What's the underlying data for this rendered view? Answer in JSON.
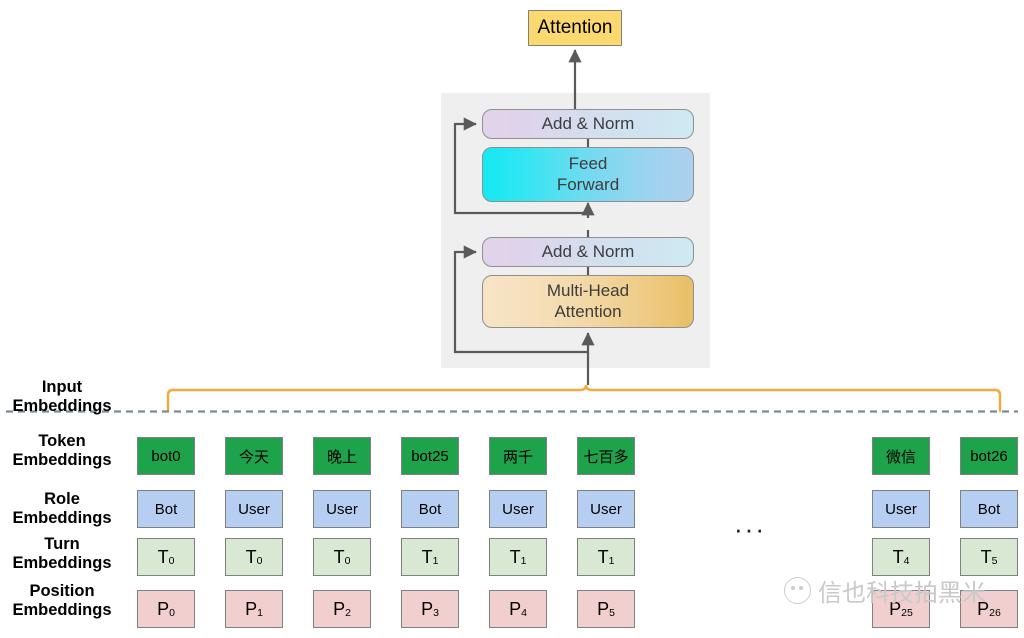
{
  "diagram": {
    "title": "Attention",
    "output_box": {
      "label": "Attention",
      "color": "#fcd96e"
    },
    "transformer_block": {
      "blocks": [
        {
          "name": "add-norm-top",
          "label": "Add & Norm",
          "lines": [
            "Add & Norm"
          ]
        },
        {
          "name": "feed-forward",
          "label": "Feed Forward",
          "lines": [
            "Feed",
            "Forward"
          ]
        },
        {
          "name": "add-norm-bottom",
          "label": "Add & Norm",
          "lines": [
            "Add & Norm"
          ]
        },
        {
          "name": "multi-head-attention",
          "label": "Multi-Head Attention",
          "lines": [
            "Multi-Head",
            "Attention"
          ]
        }
      ]
    },
    "row_labels": [
      {
        "line1": "Input",
        "line2": "Embeddings"
      },
      {
        "line1": "Token",
        "line2": "Embeddings"
      },
      {
        "line1": "Role",
        "line2": "Embeddings"
      },
      {
        "line1": "Turn",
        "line2": "Embeddings"
      },
      {
        "line1": "Position",
        "line2": "Embeddings"
      }
    ],
    "ellipsis": "···",
    "columns_left": [
      {
        "token": "bot0",
        "role": "Bot",
        "turn_base": "T",
        "turn_sub": "0",
        "pos_base": "P",
        "pos_sub": "0"
      },
      {
        "token": "今天",
        "role": "User",
        "turn_base": "T",
        "turn_sub": "0",
        "pos_base": "P",
        "pos_sub": "1"
      },
      {
        "token": "晚上",
        "role": "User",
        "turn_base": "T",
        "turn_sub": "0",
        "pos_base": "P",
        "pos_sub": "2"
      },
      {
        "token": "bot25",
        "role": "Bot",
        "turn_base": "T",
        "turn_sub": "1",
        "pos_base": "P",
        "pos_sub": "3"
      },
      {
        "token": "两千",
        "role": "User",
        "turn_base": "T",
        "turn_sub": "1",
        "pos_base": "P",
        "pos_sub": "4"
      },
      {
        "token": "七百多",
        "role": "User",
        "turn_base": "T",
        "turn_sub": "1",
        "pos_base": "P",
        "pos_sub": "5"
      }
    ],
    "columns_right": [
      {
        "token": "微信",
        "role": "User",
        "turn_base": "T",
        "turn_sub": "4",
        "pos_base": "P",
        "pos_sub": "25"
      },
      {
        "token": "bot26",
        "role": "Bot",
        "turn_base": "T",
        "turn_sub": "5",
        "pos_base": "P",
        "pos_sub": "26"
      }
    ],
    "colors": {
      "token_fill": "#1fa24c",
      "role_fill": "#b5cef2",
      "turn_fill": "#d9e8d2",
      "position_fill": "#f2cfcf",
      "bracket": "#f5a93c",
      "dashed_line": "#7b8a99",
      "block_bg": "#efefef",
      "attention_fill": "#fcd96e"
    }
  },
  "watermark": {
    "text": "信也科技拍黑米"
  }
}
